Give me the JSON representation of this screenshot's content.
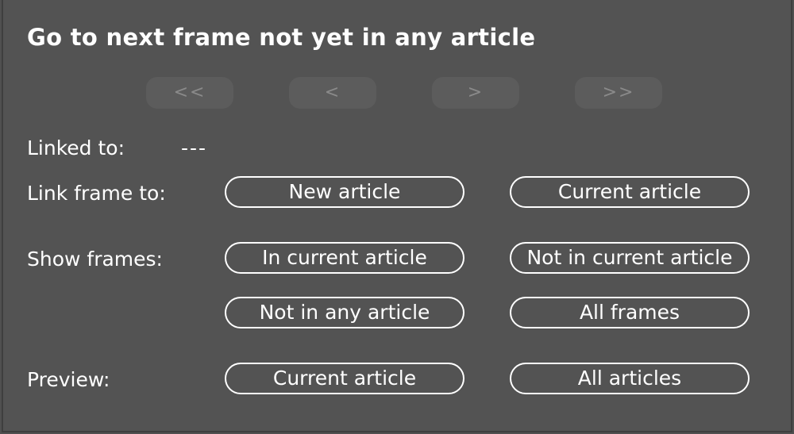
{
  "title": "Go to next frame not yet in any article",
  "navigation": {
    "first": "<<",
    "previous": "<",
    "next": ">",
    "last": ">>"
  },
  "linked_to": {
    "label": "Linked to:",
    "value": "---"
  },
  "link_frame_to": {
    "label": "Link frame to:",
    "new_article": "New article",
    "current_article": "Current article"
  },
  "show_frames": {
    "label": "Show frames:",
    "in_current_article": "In current article",
    "not_in_current_article": "Not in current article",
    "not_in_any_article": "Not in any article",
    "all_frames": "All frames"
  },
  "preview": {
    "label": "Preview:",
    "current_article": "Current article",
    "all_articles": "All articles"
  },
  "colors": {
    "background": "#535353",
    "text": "#ffffff",
    "disabled_button_bg": "#5c5c5c",
    "disabled_button_text": "#8a8a8a"
  }
}
